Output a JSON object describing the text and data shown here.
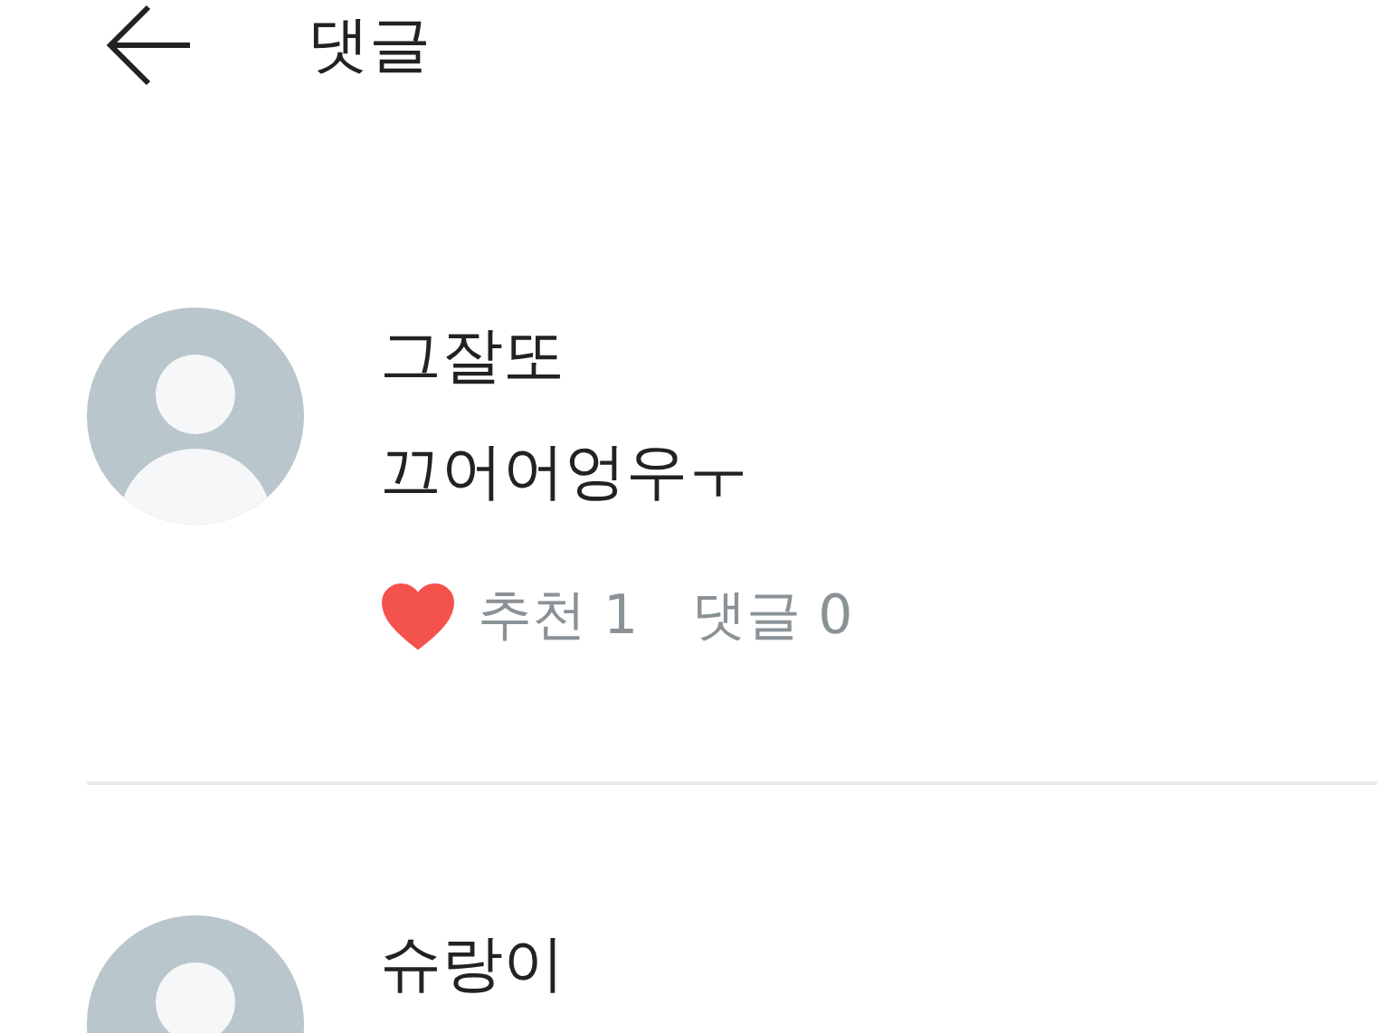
{
  "header": {
    "title": "댓글"
  },
  "comments": [
    {
      "author": "그잘또",
      "text": "끄어어엉우ㅜ",
      "liked": true,
      "like_label": "추천 1",
      "reply_label": "댓글 0"
    },
    {
      "author": "슈랑이"
    }
  ]
}
